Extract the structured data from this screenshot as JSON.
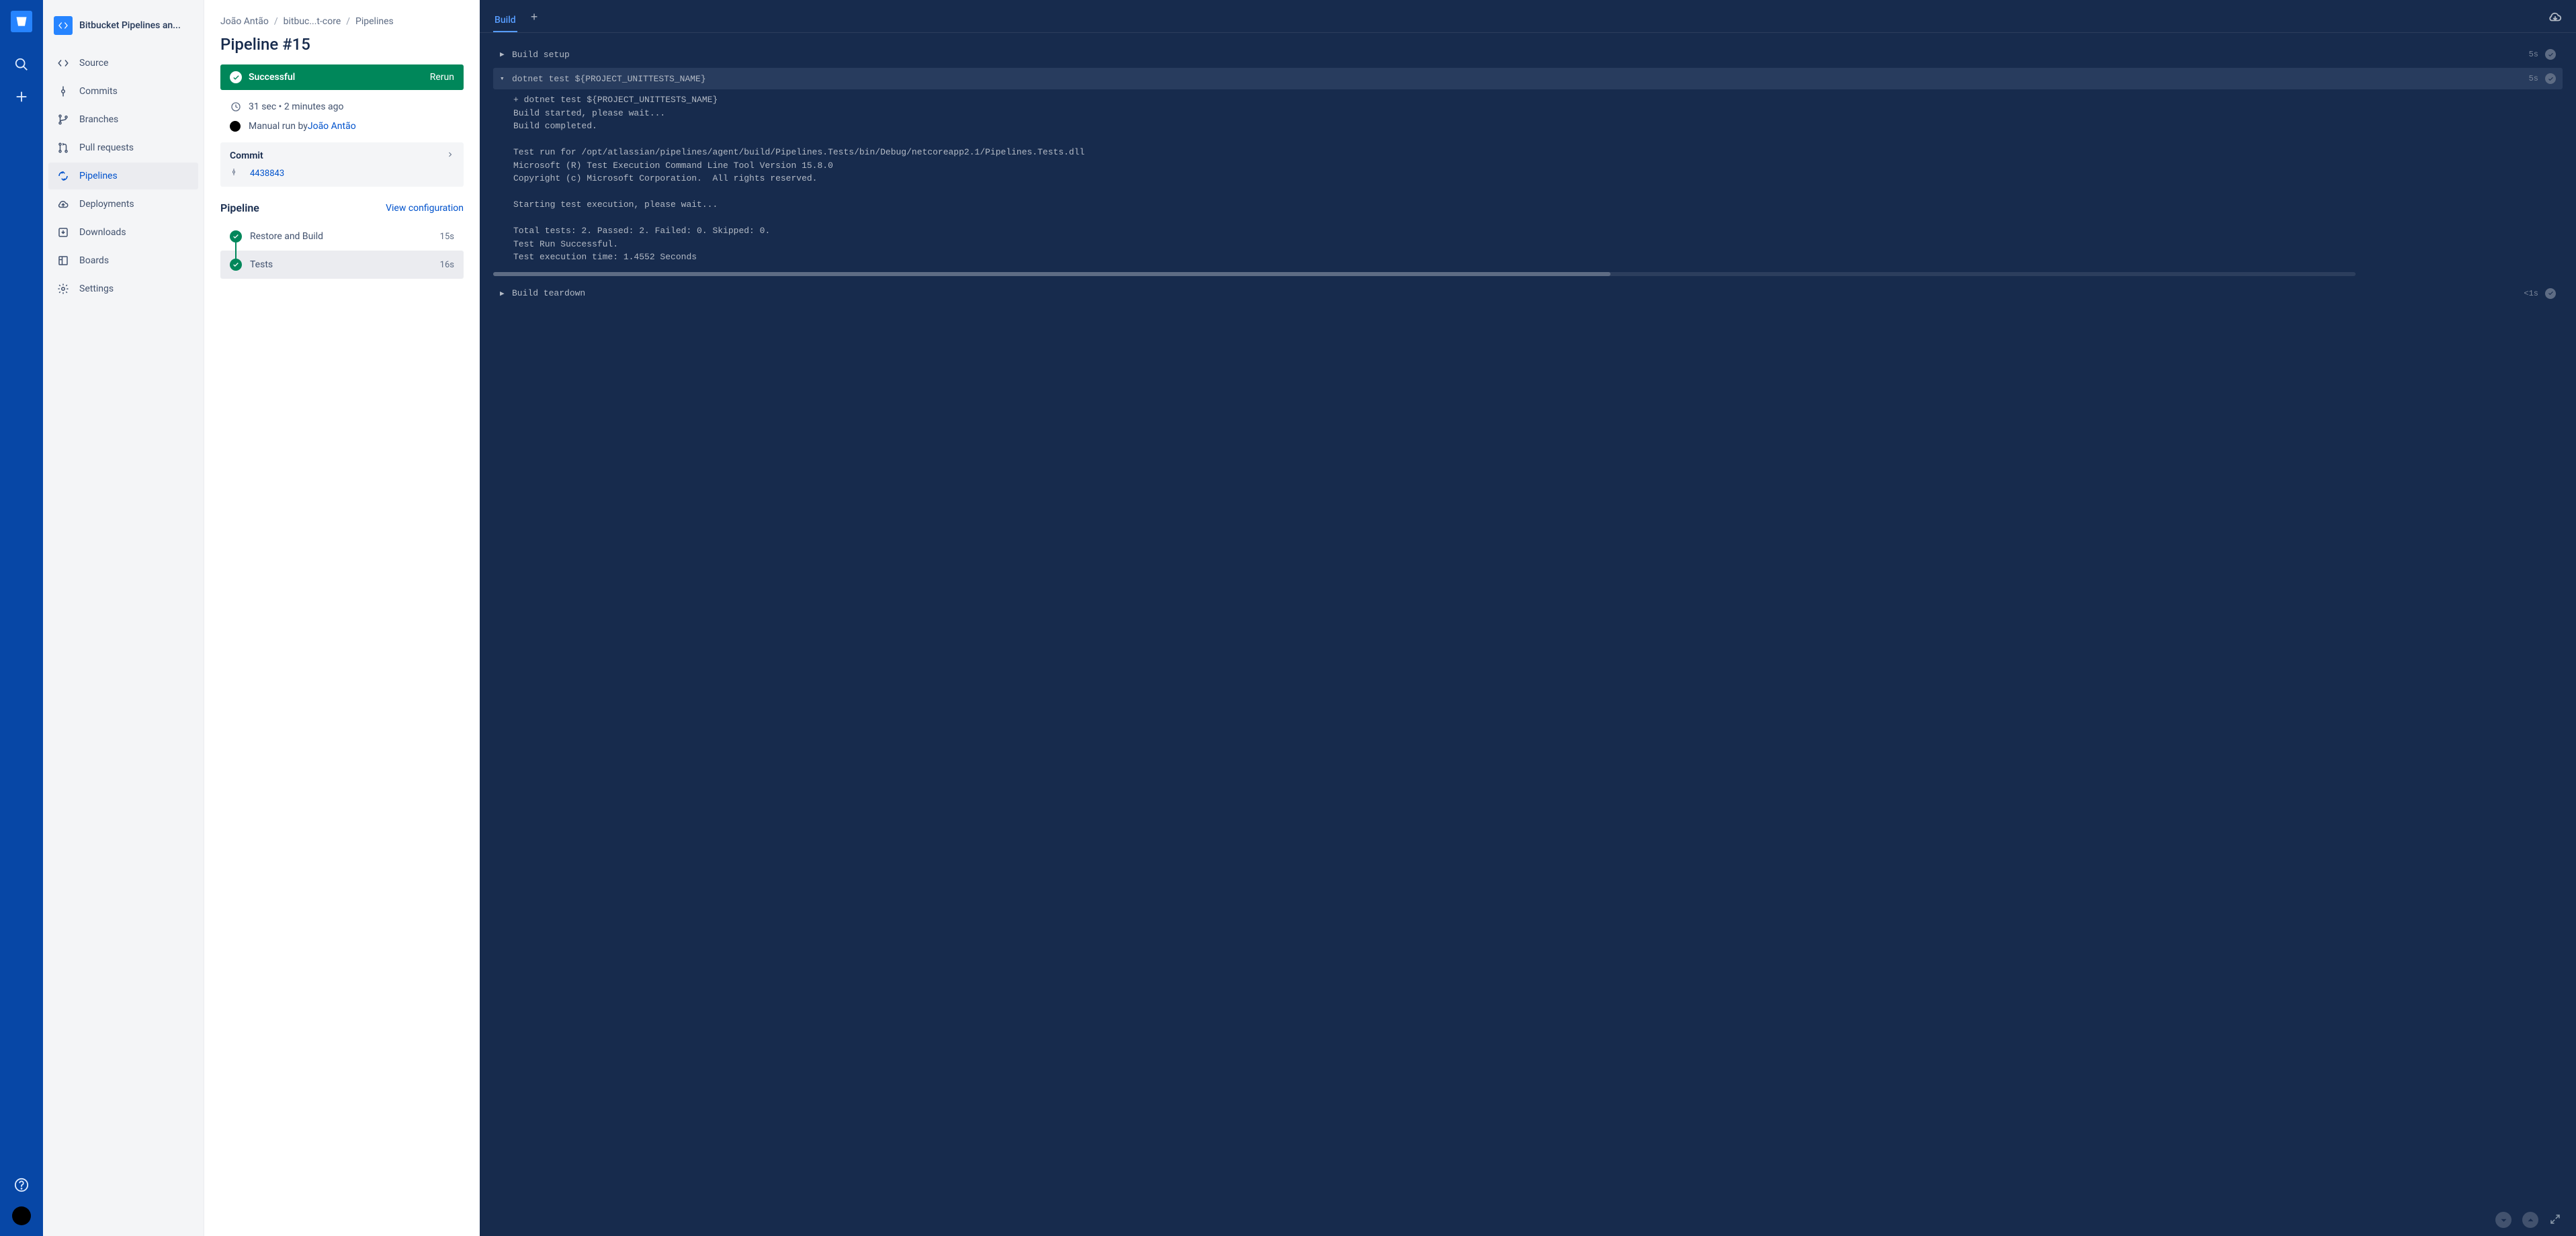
{
  "repo_name": "Bitbucket Pipelines an...",
  "sidebar": {
    "items": [
      {
        "label": "Source"
      },
      {
        "label": "Commits"
      },
      {
        "label": "Branches"
      },
      {
        "label": "Pull requests"
      },
      {
        "label": "Pipelines"
      },
      {
        "label": "Deployments"
      },
      {
        "label": "Downloads"
      },
      {
        "label": "Boards"
      },
      {
        "label": "Settings"
      }
    ]
  },
  "breadcrumb": {
    "owner": "João Antão",
    "repo": "bitbuc...t-core",
    "section": "Pipelines"
  },
  "page_title": "Pipeline #15",
  "status": {
    "label": "Successful",
    "rerun": "Rerun"
  },
  "meta": {
    "duration": "31 sec • 2 minutes ago",
    "run_prefix": "Manual run by ",
    "run_by": "João Antão"
  },
  "commit": {
    "title": "Commit",
    "hash": "4438843"
  },
  "pipeline_section": {
    "title": "Pipeline",
    "view_config": "View configuration",
    "steps": [
      {
        "name": "Restore and Build",
        "time": "15s"
      },
      {
        "name": "Tests",
        "time": "16s"
      }
    ]
  },
  "terminal": {
    "tab_build": "Build",
    "sections": [
      {
        "title": "Build setup",
        "time": "5s",
        "expanded": false
      },
      {
        "title": "dotnet test ${PROJECT_UNITTESTS_NAME}",
        "time": "5s",
        "expanded": true
      },
      {
        "title": "Build teardown",
        "time": "<1s",
        "expanded": false
      }
    ],
    "log_lines": [
      "+ dotnet test ${PROJECT_UNITTESTS_NAME}",
      "Build started, please wait...",
      "Build completed.",
      "",
      "Test run for /opt/atlassian/pipelines/agent/build/Pipelines.Tests/bin/Debug/netcoreapp2.1/Pipelines.Tests.dll",
      "Microsoft (R) Test Execution Command Line Tool Version 15.8.0",
      "Copyright (c) Microsoft Corporation.  All rights reserved.",
      "",
      "Starting test execution, please wait...",
      "",
      "Total tests: 2. Passed: 2. Failed: 0. Skipped: 0.",
      "Test Run Successful.",
      "Test execution time: 1.4552 Seconds"
    ]
  }
}
